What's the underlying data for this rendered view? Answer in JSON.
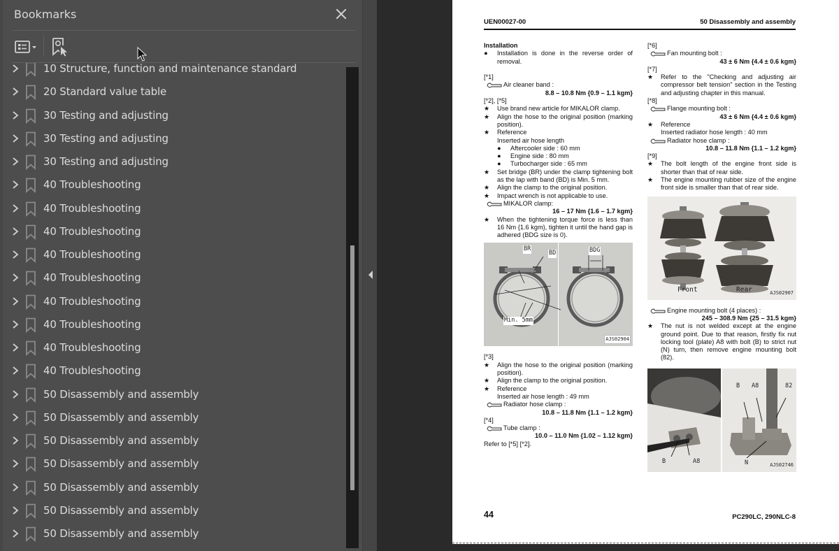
{
  "bookmarks_panel": {
    "title": "Bookmarks",
    "close_label": "✕",
    "toolbar": {
      "options_button": "options-menu",
      "find_bookmark_button": "find-current-bookmark"
    },
    "items": [
      {
        "label": "10 Structure, function and maintenance standard"
      },
      {
        "label": "20 Standard value table"
      },
      {
        "label": "30 Testing and adjusting"
      },
      {
        "label": "30 Testing and adjusting"
      },
      {
        "label": "30 Testing and adjusting"
      },
      {
        "label": "40 Troubleshooting"
      },
      {
        "label": "40 Troubleshooting"
      },
      {
        "label": "40 Troubleshooting"
      },
      {
        "label": "40 Troubleshooting"
      },
      {
        "label": "40 Troubleshooting"
      },
      {
        "label": "40 Troubleshooting"
      },
      {
        "label": "40 Troubleshooting"
      },
      {
        "label": "40 Troubleshooting"
      },
      {
        "label": "40 Troubleshooting"
      },
      {
        "label": "50 Disassembly and assembly"
      },
      {
        "label": "50 Disassembly and assembly"
      },
      {
        "label": "50 Disassembly and assembly"
      },
      {
        "label": "50 Disassembly and assembly"
      },
      {
        "label": "50 Disassembly and assembly"
      },
      {
        "label": "50 Disassembly and assembly"
      },
      {
        "label": "50 Disassembly and assembly"
      }
    ],
    "scroll": {
      "thumb_start_fraction": 0.37,
      "thumb_end_fraction": 0.88
    }
  },
  "page": {
    "header_left": "UEN00027-00",
    "header_right": "50 Disassembly and assembly",
    "footer_page_number": "44",
    "footer_model": "PC290LC, 290NLC-8",
    "left_column": {
      "heading": "Installation",
      "intro_bullet": "Installation is done in the reverse order of removal.",
      "s1_ref": "[*1]",
      "s1_torque_label": "Air cleaner band :",
      "s1_torque_value": "8.8 – 10.8 Nm {0.9 – 1.1 kgm}",
      "s2_ref": "[*2], [*5]",
      "s2_star1": "Use brand new article for MIKALOR clamp.",
      "s2_star2": "Align the hose to the original position (marking position).",
      "s2_star3": "Reference",
      "s2_star3_sub": "Inserted air hose length",
      "s2_dots": [
        "Aftercooler side : 60 mm",
        "Engine side : 80 mm",
        "Turbocharger side : 65 mm"
      ],
      "s2_star4": "Set bridge (BR) under the clamp tightening bolt as the lap with band (BD) is Min. 5 mm.",
      "s2_star5": "Align the clamp to the original position.",
      "s2_star6": "Impact wrench is not applicable to use.",
      "s2_torque_label": "MIKALOR clamp:",
      "s2_torque_value": "16 – 17 Nm {1.6 – 1.7 kgm}",
      "s2_star7": "When the tightening torque force is less than 16 Nm {1.6 kgm}, tighten it until the hand gap is adhered (BDG size is 0).",
      "photo1": {
        "labels": [
          "BR",
          "BD",
          "BDG",
          "Min. 5mm"
        ],
        "code": "AJS02904"
      },
      "s3_ref": "[*3]",
      "s3_star1": "Align the hose to the original position (marking position).",
      "s3_star2": "Align the clamp to the original position.",
      "s3_star3": "Reference",
      "s3_star3_sub": "Inserted air hose length : 49 mm",
      "s3_torque_label": "Radiator hose clamp :",
      "s3_torque_value": "10.8 – 11.8 Nm {1.1 – 1.2 kgm}",
      "s4_ref": "[*4]",
      "s4_torque_label": "Tube clamp :",
      "s4_torque_value": "10.0 – 11.0 Nm {1.02 – 1.12 kgm}",
      "s4_note": "Refer to [*5] [*2]."
    },
    "right_column": {
      "s6_ref": "[*6]",
      "s6_torque_label": "Fan mounting bolt :",
      "s6_torque_value": "43 ± 6 Nm {4.4 ± 0.6 kgm}",
      "s7_ref": "[*7]",
      "s7_star1": "Refer to the \"Checking and adjusting air compressor belt tension\" section in the Testing and adjusting chapter in this manual.",
      "s8_ref": "[*8]",
      "s8_torque_label": "Flange mounting bolt :",
      "s8_torque_value": "43 ± 6 Nm {4.4 ± 0.6 kgm}",
      "s8_star1": "Reference",
      "s8_star1_sub": "Inserted radiator hose length : 40 mm",
      "s8_torque2_label": "Radiator hose clamp :",
      "s8_torque2_value": "10.8 – 11.8 Nm {1.1 – 1.2 kgm}",
      "s9_ref": "[*9]",
      "s9_star1": "The bolt length of the engine front side is shorter than that of rear side.",
      "s9_star2": "The engine mounting rubber size of the engine front side is smaller than that of rear side.",
      "photo2": {
        "labels": [
          "Front",
          "Rear"
        ],
        "code": "AJS02907"
      },
      "s9_torque_label": "Engine mounting bolt (4 places) :",
      "s9_torque_value": "245 – 308.9 Nm {25 – 31.5 kgm}",
      "s9_star3": "The nut is not welded except at the engine ground point. Due to that reason, firstly fix nut locking tool (plate) A8 with bolt (B) to strict nut (N) turn, then remove engine mounting bolt (82).",
      "photo3": {
        "labels": [
          "B",
          "A8",
          "B",
          "A8",
          "82",
          "N"
        ],
        "code": "AJS02746"
      }
    }
  },
  "symbols": {
    "star": "★",
    "dot": "●"
  }
}
